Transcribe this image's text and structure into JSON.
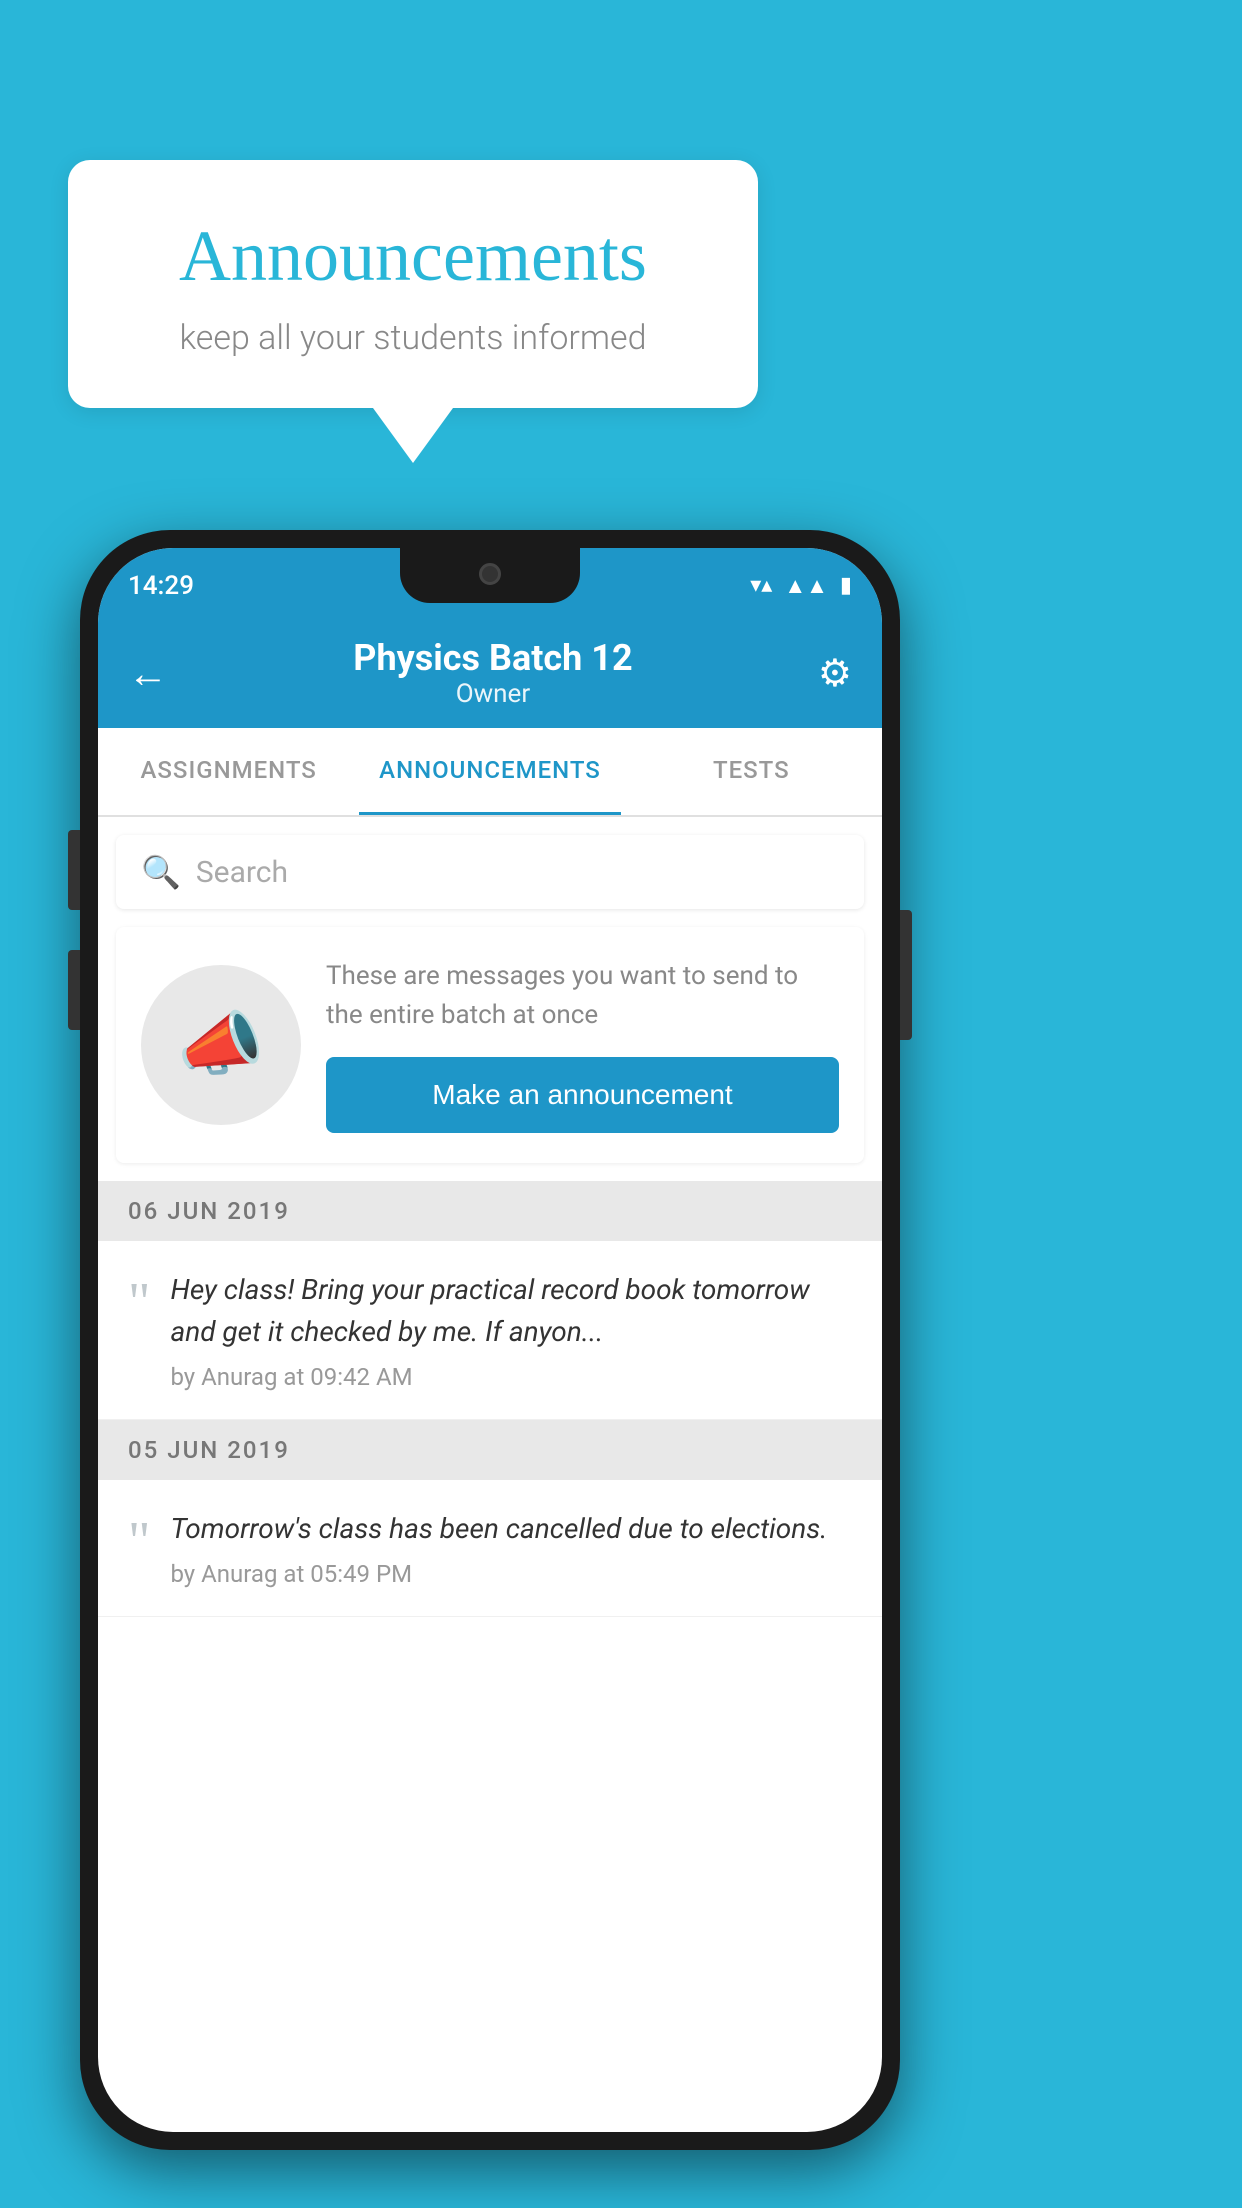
{
  "background_color": "#29b6d8",
  "speech_bubble": {
    "title": "Announcements",
    "subtitle": "keep all your students informed"
  },
  "phone": {
    "status_bar": {
      "time": "14:29",
      "icons": [
        "wifi",
        "signal",
        "battery"
      ]
    },
    "header": {
      "title": "Physics Batch 12",
      "subtitle": "Owner",
      "back_label": "←",
      "gear_label": "⚙"
    },
    "tabs": [
      {
        "label": "ASSIGNMENTS",
        "active": false
      },
      {
        "label": "ANNOUNCEMENTS",
        "active": true
      },
      {
        "label": "TESTS",
        "active": false
      }
    ],
    "search": {
      "placeholder": "Search"
    },
    "promo": {
      "description": "These are messages you want to send to the entire batch at once",
      "button_label": "Make an announcement"
    },
    "announcements": [
      {
        "date": "06  JUN  2019",
        "text": "Hey class! Bring your practical record book tomorrow and get it checked by me. If anyon...",
        "author": "by Anurag at 09:42 AM"
      },
      {
        "date": "05  JUN  2019",
        "text": "Tomorrow's class has been cancelled due to elections.",
        "author": "by Anurag at 05:49 PM"
      }
    ]
  }
}
